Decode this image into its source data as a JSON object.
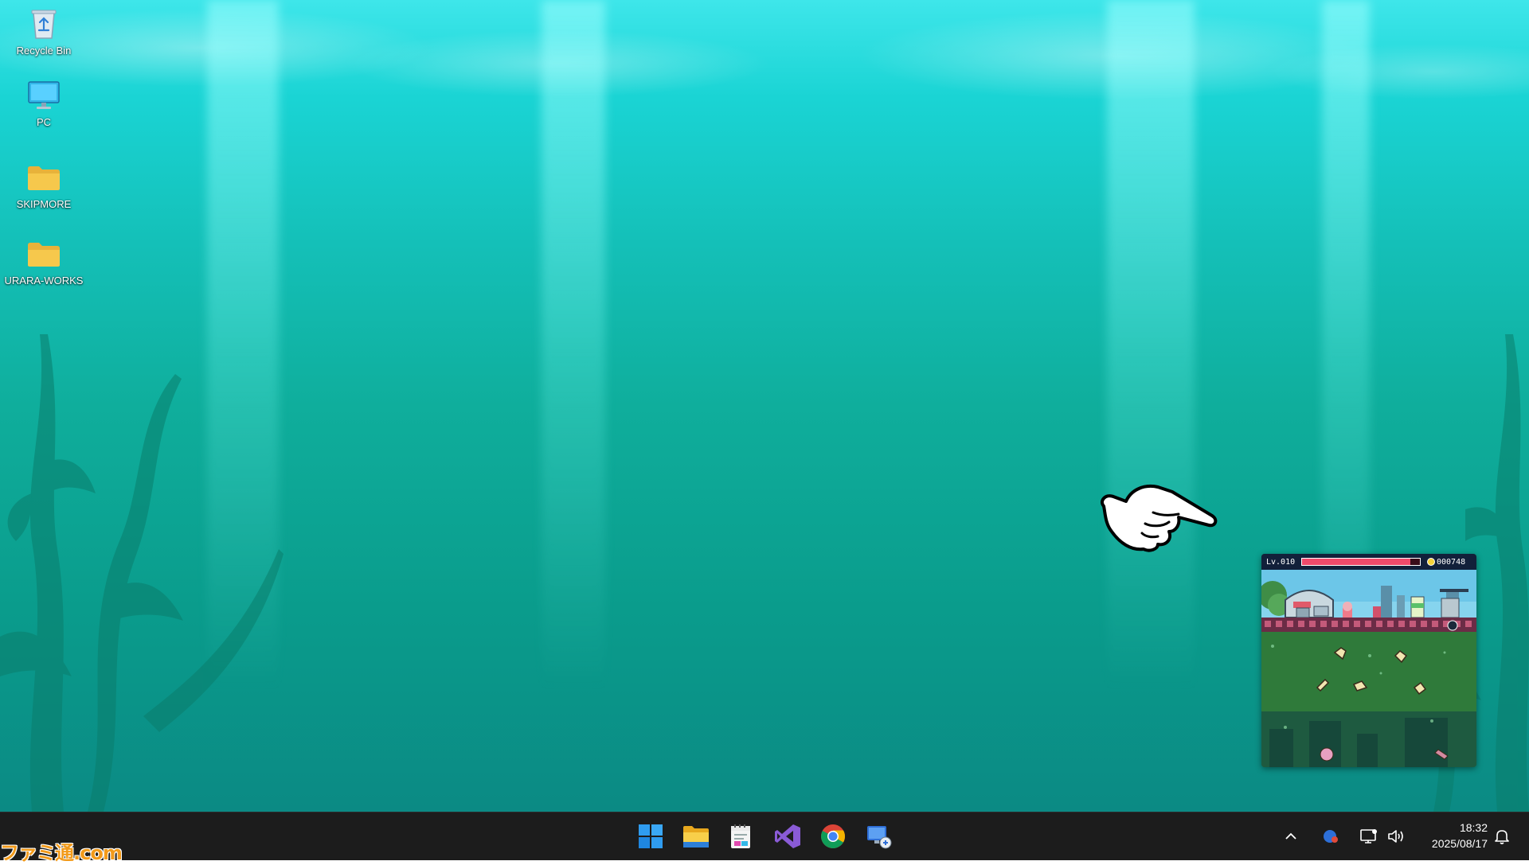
{
  "desktop": {
    "icons": [
      {
        "label": "Recycle Bin",
        "icon": "recycle-bin-icon"
      },
      {
        "label": "PC",
        "icon": "monitor-icon"
      },
      {
        "label": "SKIPMORE",
        "icon": "folder-icon"
      },
      {
        "label": "URARA-WORKS",
        "icon": "folder-icon"
      }
    ]
  },
  "game_widget": {
    "level": "Lv.010",
    "coins": "000748",
    "hp_fraction": 0.92
  },
  "taskbar": {
    "apps": [
      {
        "name": "Start",
        "icon": "windows-start-icon"
      },
      {
        "name": "File Explorer",
        "icon": "file-explorer-icon"
      },
      {
        "name": "Notepad",
        "icon": "notepad-icon"
      },
      {
        "name": "Visual Studio",
        "icon": "visual-studio-icon"
      },
      {
        "name": "Google Chrome",
        "icon": "chrome-icon"
      },
      {
        "name": "Remote Desktop",
        "icon": "remote-desktop-icon"
      }
    ],
    "tray": {
      "time": "18:32",
      "date": "2025/08/17"
    }
  },
  "colors": {
    "taskbar_bg": "#1c1c1c",
    "water_top": "#3ee6ea",
    "water_bottom": "#0b8a84",
    "hp_bar": "#ef4a6b",
    "folder": "#f6c84c"
  },
  "watermark": "ファミ通.com"
}
